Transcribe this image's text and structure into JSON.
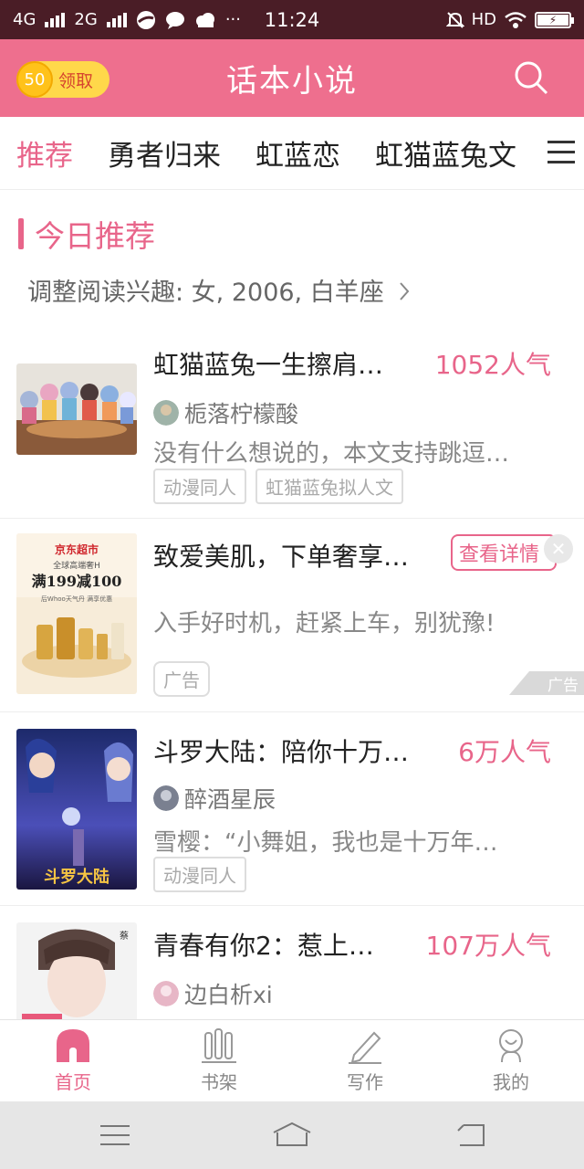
{
  "status": {
    "network1": "4G",
    "network2": "2G",
    "more": "···",
    "time": "11:24",
    "hd": "HD"
  },
  "header": {
    "coin_amount": "50",
    "coin_label": "领取",
    "title": "话本小说"
  },
  "tabs": [
    {
      "label": "推荐"
    },
    {
      "label": "勇者归来"
    },
    {
      "label": "虹蓝恋"
    },
    {
      "label": "虹猫蓝兔文"
    }
  ],
  "section": {
    "title": "今日推荐",
    "interest": "调整阅读兴趣: 女, 2006, 白羊座"
  },
  "cards": [
    {
      "title": "虹猫蓝兔一生擦肩…",
      "popularity": "1052人气",
      "author": "栀落柠檬酸",
      "desc": "没有什么想说的，本文支持跳逗…",
      "tags": [
        "动漫同人",
        "虹猫蓝兔拟人文"
      ]
    },
    {
      "title": "斗罗大陆：陪你十万…",
      "popularity": "6万人气",
      "author": "醉酒星辰",
      "desc": "雪樱：“小舞姐，我也是十万年…",
      "tags": [
        "动漫同人"
      ]
    },
    {
      "title": "青春有你2：惹上…",
      "popularity": "107万人气",
      "author": "边白析xi",
      "desc": ""
    }
  ],
  "ad": {
    "title": "致爱美肌，下单奢享…",
    "button": "查看详情",
    "desc": "入手好时机，赶紧上车，别犹豫!",
    "tag": "广告",
    "mark": "广告",
    "cover_brand": "京东超市",
    "cover_line1": "全球高端奢H",
    "cover_line2": "满199减100",
    "cover_line3": "后Whoo天气丹 满享优惠"
  },
  "nav": [
    {
      "label": "首页"
    },
    {
      "label": "书架"
    },
    {
      "label": "写作"
    },
    {
      "label": "我的"
    }
  ],
  "colors": {
    "accent": "#e8658a",
    "appbar": "#ee6f8e",
    "statusbar": "#4a1d26"
  }
}
